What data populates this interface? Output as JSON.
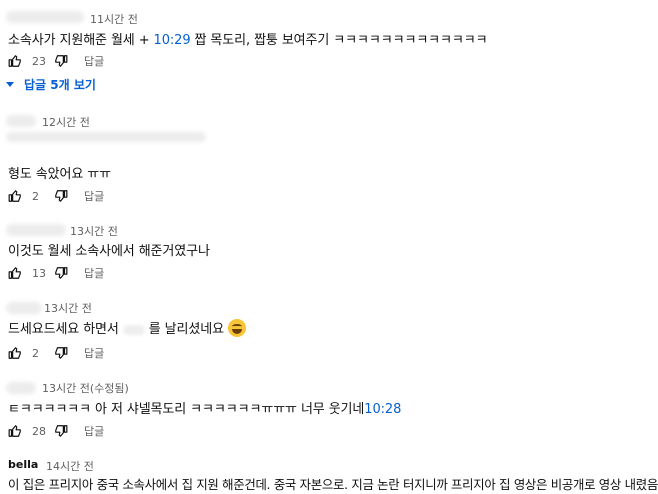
{
  "comments": [
    {
      "time": "11시간 전",
      "text_before": "소속사가 지원해준 월세 + ",
      "timestamp_link": "10:29",
      "text_after": " 짭 목도리, 짭퉁 보여주기 ㅋㅋㅋㅋㅋㅋㅋㅋㅋㅋㅋㅋㅋ",
      "likes": "23",
      "reply_label": "답글"
    },
    {
      "time": "12시간 전",
      "text": "형도 속았어요 ㅠㅠ",
      "likes": "2",
      "reply_label": "답글"
    },
    {
      "time": "13시간 전",
      "text": "이것도 월세 소속사에서 해준거였구나",
      "likes": "13",
      "reply_label": "답글"
    },
    {
      "time": "13시간 전",
      "text_before": "드세요드세요 하면서",
      "text_after": "를 날리셨네요",
      "emoji": "rolling-on-floor-laughing",
      "likes": "2",
      "reply_label": "답글"
    },
    {
      "time": "13시간 전(수정됨)",
      "text_before": "ㅌㅋㅋㅋㅋㅋㅋ 아 저 샤넬목도리 ㅋㅋㅋㅋㅋㅋㅠㅠㅠ 너무 웃기네",
      "timestamp_link": "10:28",
      "likes": "28",
      "reply_label": "답글"
    },
    {
      "author": "bella",
      "time": "14시간 전",
      "text": "이 집은 프리지아 중국 소속사에서 집 지원 해준건데. 중국 자본으로. 지금 논란 터지니까 프리지아 집 영상은 비공개로 영상 내렸음."
    }
  ],
  "replies_toggle": "답글 5개 보기",
  "colors": {
    "link": "#065fd4",
    "meta": "#606060",
    "text": "#0f0f0f"
  }
}
